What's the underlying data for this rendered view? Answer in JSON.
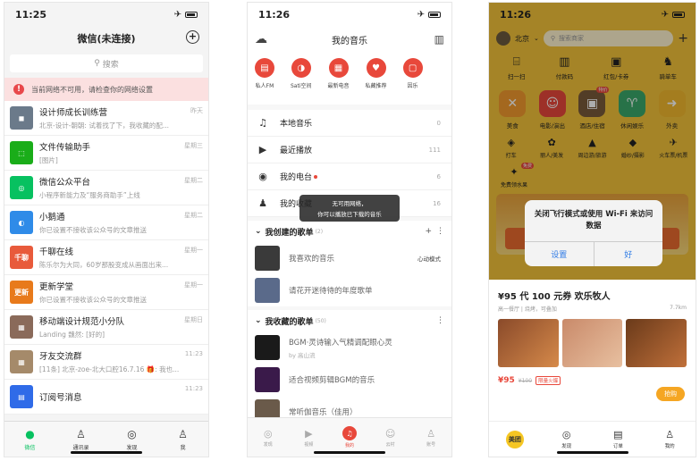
{
  "colors": {
    "wechat_green": "#07c160",
    "netease_red": "#e8483b",
    "meituan_yellow": "#f3c33a",
    "ios_blue": "#2f7be6"
  },
  "wechat": {
    "time": "11:25",
    "title": "微信(未连接)",
    "search_placeholder": "搜索",
    "warning": "当前网络不可用，请检查你的网络设置",
    "chats": [
      {
        "name": "设计师成长训练营",
        "msg": "北京-设计-朝朝: 试着找了下，我收藏的配...",
        "time": "昨天",
        "color": "#6b7a8a",
        "avatar": "◼"
      },
      {
        "name": "文件传输助手",
        "msg": "[图片]",
        "time": "星期三",
        "color": "#1aad19",
        "avatar": "⬚"
      },
      {
        "name": "微信公众平台",
        "msg": "小程序新能力及“服务商助手”上线",
        "time": "星期二",
        "color": "#07c160",
        "avatar": "◎"
      },
      {
        "name": "小鹅通",
        "msg": "你已设置不接收该公众号的文章推送",
        "time": "星期二",
        "color": "#2f8be8",
        "avatar": "◐"
      },
      {
        "name": "千聊在线",
        "msg": "陈乐尔为大同，60岁那股变成从画面出来...",
        "time": "星期一",
        "color": "#e85a3b",
        "avatar": "千聊"
      },
      {
        "name": "更新学堂",
        "msg": "你已设置不接收该公众号的文章推送",
        "time": "星期一",
        "color": "#e87a1b",
        "avatar": "更新"
      },
      {
        "name": "移动端设计规范小分队",
        "msg": "Landing 魏然: [好的]",
        "time": "星期日",
        "color": "#8a6a5a",
        "avatar": "▦"
      },
      {
        "name": "牙友交流群",
        "msg": "[11条] 北京-zoe-北大口腔16.7.16 🎁: 我也...",
        "time": "11:23",
        "color": "#a58a6a",
        "avatar": "▦"
      },
      {
        "name": "订阅号消息",
        "msg": "",
        "time": "11:23",
        "color": "#2f6be8",
        "avatar": "▤"
      }
    ],
    "tabs": [
      {
        "label": "微信",
        "icon": "chat-icon",
        "glyph": "●"
      },
      {
        "label": "通讯录",
        "icon": "contacts-icon",
        "glyph": "♙"
      },
      {
        "label": "发现",
        "icon": "compass-icon",
        "glyph": "◎"
      },
      {
        "label": "我",
        "icon": "person-icon",
        "glyph": "♙"
      }
    ]
  },
  "netease": {
    "time": "11:26",
    "title": "我的音乐",
    "quick": [
      {
        "label": "私人FM",
        "glyph": "▤"
      },
      {
        "label": "Sati空间",
        "glyph": "◑"
      },
      {
        "label": "最新电音",
        "glyph": "▦"
      },
      {
        "label": "私藏推荐",
        "glyph": "♥"
      },
      {
        "label": "因乐",
        "glyph": "▢"
      }
    ],
    "rows": [
      {
        "label": "本地音乐",
        "count": "0",
        "glyph": "♫"
      },
      {
        "label": "最近播放",
        "count": "111",
        "glyph": "▶"
      },
      {
        "label": "我的电台",
        "count": "6",
        "glyph": "◉"
      },
      {
        "label": "我的收藏",
        "count": "16",
        "glyph": "♟"
      }
    ],
    "toast_line1": "无可用网络，",
    "toast_line2": "你可以播放已下载的音乐",
    "created_title": "我创建的歌单",
    "created_count": "(2)",
    "created": [
      {
        "title": "我喜欢的音乐",
        "sub": "",
        "color": "#3a3a3a"
      },
      {
        "title": "请花开迷待待的年度歌单",
        "sub": "",
        "color": "#5a6a8a"
      }
    ],
    "heart_mode": "心动模式",
    "collected_title": "我收藏的歌单",
    "collected_count": "(50)",
    "collected": [
      {
        "title": "BGM·灵诗输入气精调配眼心灵",
        "sub": "by 高山流",
        "color": "#1a1a1a"
      },
      {
        "title": "适合视频剪辑BGM的音乐",
        "sub": "",
        "color": "#3a1a4a"
      },
      {
        "title": "常听伽音乐（佳用）",
        "sub": "",
        "color": "#6a5a4a"
      }
    ],
    "tabs": [
      "发现",
      "视频",
      "我的",
      "云村",
      "账号"
    ]
  },
  "meituan": {
    "time": "11:26",
    "city": "北京",
    "search_placeholder": "搜索商家",
    "quick": [
      {
        "label": "扫一扫",
        "glyph": "⌸"
      },
      {
        "label": "付款码",
        "glyph": "▥"
      },
      {
        "label": "红包/卡券",
        "glyph": "▣"
      },
      {
        "label": "骑单车",
        "glyph": "♞"
      }
    ],
    "grid": [
      {
        "label": "美食",
        "color": "#f29a2e",
        "glyph": "✕",
        "badge": ""
      },
      {
        "label": "电影/演出",
        "color": "#e8483b",
        "glyph": "☺",
        "badge": ""
      },
      {
        "label": "酒店/住宿",
        "color": "#7a5a3a",
        "glyph": "▣",
        "badge": "特价"
      },
      {
        "label": "休闲娱乐",
        "color": "#3aa86a",
        "glyph": "♈",
        "badge": ""
      },
      {
        "label": "外卖",
        "color": "#f2b82e",
        "glyph": "➜",
        "badge": ""
      }
    ],
    "small": [
      {
        "label": "打车",
        "glyph": "◈"
      },
      {
        "label": "丽人/美发",
        "glyph": "✿"
      },
      {
        "label": "周边游/旅游",
        "glyph": "▲"
      },
      {
        "label": "婚纱/摄影",
        "glyph": "◆"
      },
      {
        "label": "火车票/机票",
        "glyph": "✈"
      }
    ],
    "small2": [
      {
        "label": "免费领水果",
        "glyph": "✦",
        "badge": "免费"
      }
    ],
    "alert_msg": "关闭飞行模式或使用 Wi-Fi 来访问数据",
    "alert_settings": "设置",
    "alert_ok": "好",
    "deal_title": "¥95 代 100 元券 欢乐牧人",
    "deal_sub": "高一餐厅 | 烧烤，可叠加",
    "deal_dist": "7.7km",
    "price": "¥95",
    "old_price": "¥100",
    "tag": "限量火爆",
    "buy": "抢购",
    "tabs": [
      {
        "label": "美团",
        "glyph": "美团"
      },
      {
        "label": "发现",
        "glyph": "◎"
      },
      {
        "label": "订单",
        "glyph": "▤"
      },
      {
        "label": "我的",
        "glyph": "♙"
      }
    ]
  }
}
